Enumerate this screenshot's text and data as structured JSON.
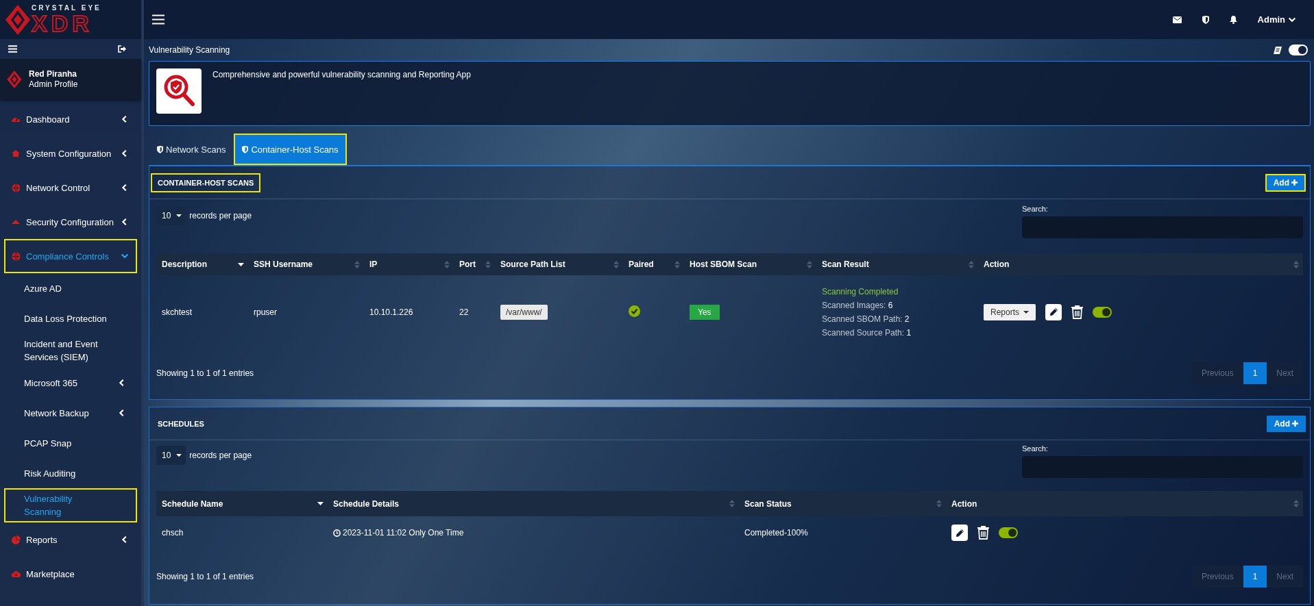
{
  "brand": {
    "tagline": "CRYSTAL EYE",
    "name": "XDR"
  },
  "topbar": {
    "user": "Admin"
  },
  "profile": {
    "name": "Red Piranha",
    "role": "Admin Profile"
  },
  "sidebar": {
    "items": [
      {
        "label": "Dashboard",
        "kind": "group",
        "selected": false,
        "expanded": false,
        "highlighted": false
      },
      {
        "label": "System Configuration",
        "kind": "group",
        "selected": false,
        "expanded": false,
        "highlighted": false
      },
      {
        "label": "Network Control",
        "kind": "group",
        "selected": false,
        "expanded": false,
        "highlighted": false
      },
      {
        "label": "Security Configuration",
        "kind": "group",
        "selected": false,
        "expanded": false,
        "highlighted": false
      },
      {
        "label": "Compliance Controls",
        "kind": "group",
        "selected": true,
        "expanded": true,
        "highlighted": true,
        "children": [
          {
            "label": "Azure AD",
            "kind": "link",
            "selected": false,
            "highlighted": false
          },
          {
            "label": "Data Loss Protection",
            "kind": "link",
            "selected": false,
            "highlighted": false
          },
          {
            "label": "Incident and Event Services (SIEM)",
            "kind": "link",
            "selected": false,
            "highlighted": false
          },
          {
            "label": "Microsoft 365",
            "kind": "group",
            "selected": false,
            "expanded": false,
            "highlighted": false
          },
          {
            "label": "Network Backup",
            "kind": "group",
            "selected": false,
            "expanded": false,
            "highlighted": false
          },
          {
            "label": "PCAP Snap",
            "kind": "link",
            "selected": false,
            "highlighted": false
          },
          {
            "label": "Risk Auditing",
            "kind": "link",
            "selected": false,
            "highlighted": false
          },
          {
            "label": "Vulnerability Scanning",
            "kind": "link",
            "selected": true,
            "highlighted": true
          }
        ]
      },
      {
        "label": "Reports",
        "kind": "group",
        "selected": false,
        "expanded": false,
        "highlighted": false
      },
      {
        "label": "Marketplace",
        "kind": "link",
        "selected": false,
        "highlighted": false
      }
    ]
  },
  "page": {
    "title": "Vulnerability Scanning",
    "app_description": "Comprehensive and powerful vulnerability scanning and Reporting App"
  },
  "tabs": [
    {
      "label": "Network Scans",
      "selected": false,
      "highlighted": false
    },
    {
      "label": "Container-Host Scans",
      "selected": true,
      "highlighted": true
    }
  ],
  "panels": [
    {
      "title": "CONTAINER-HOST SCANS",
      "title_highlighted": true,
      "add_button": "Add",
      "add_highlighted": true,
      "page_length": "10",
      "length_label": "records per page",
      "search_label": "Search:",
      "columns": [
        {
          "label": "Description",
          "sorted": true
        },
        {
          "label": "SSH Username",
          "sorted": false
        },
        {
          "label": "IP",
          "sorted": false
        },
        {
          "label": "Port",
          "sorted": false
        },
        {
          "label": "Source Path List",
          "sorted": false
        },
        {
          "label": "Paired",
          "sorted": false
        },
        {
          "label": "Host SBOM Scan",
          "sorted": false
        },
        {
          "label": "Scan Result",
          "sorted": false
        },
        {
          "label": "Action",
          "sorted": false
        }
      ],
      "rows": [
        [
          {
            "kind": "text",
            "text": "skchtest"
          },
          {
            "kind": "text",
            "text": "rpuser"
          },
          {
            "kind": "text",
            "text": "10.10.1.226"
          },
          {
            "kind": "text",
            "text": "22"
          },
          {
            "kind": "chip",
            "text": "/var/www/"
          },
          {
            "kind": "check",
            "checked": true
          },
          {
            "kind": "badge",
            "text": "Yes"
          },
          {
            "kind": "result",
            "status": "Scanning Completed",
            "lines": [
              "Scanned Images: **6**",
              "Scanned SBOM Path: **2**",
              "Scanned Source Path: **1**"
            ]
          },
          {
            "kind": "actions",
            "reports": "Reports",
            "enabled": true
          }
        ]
      ],
      "info": "Showing 1 to 1 of 1 entries",
      "pager": {
        "previous": "Previous",
        "pages": [
          {
            "label": "1",
            "selected": true
          }
        ],
        "next": "Next"
      }
    },
    {
      "title": "SCHEDULES",
      "title_highlighted": false,
      "add_button": "Add",
      "add_highlighted": false,
      "page_length": "10",
      "length_label": "records per page",
      "search_label": "Search:",
      "columns": [
        {
          "label": "Schedule Name",
          "sorted": true
        },
        {
          "label": "Schedule Details",
          "sorted": false
        },
        {
          "label": "Scan Status",
          "sorted": false
        },
        {
          "label": "Action",
          "sorted": false
        }
      ],
      "rows": [
        [
          {
            "kind": "text",
            "text": "chsch"
          },
          {
            "kind": "datetime",
            "text": "2023-11-01 11:02 Only One Time"
          },
          {
            "kind": "text",
            "text": "Completed-100%"
          },
          {
            "kind": "actions",
            "enabled": true
          }
        ]
      ],
      "info": "Showing 1 to 1 of 1 entries",
      "pager": {
        "previous": "Previous",
        "pages": [
          {
            "label": "1",
            "selected": true
          }
        ],
        "next": "Next"
      }
    }
  ]
}
